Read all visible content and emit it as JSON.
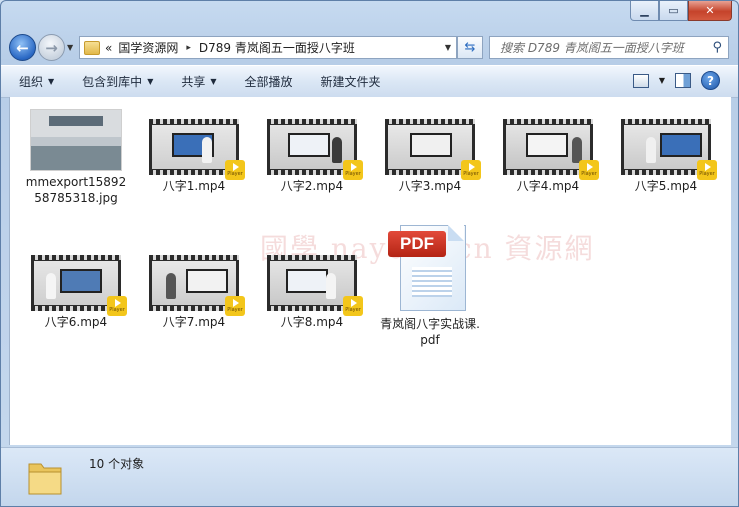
{
  "window": {
    "min_label": "▁",
    "max_label": "▭",
    "close_label": "✕"
  },
  "nav": {
    "back_icon": "arrow-left-icon",
    "forward_icon": "arrow-right-icon",
    "breadcrumb": {
      "overflow": "«",
      "parent": "国学资源网",
      "separator": "▸",
      "current": "D789 青岚阁五一面授八字班"
    },
    "search_placeholder": "搜索 D789 青岚阁五一面授八字班"
  },
  "toolbar": {
    "organize": "组织",
    "include_in_library": "包含到库中",
    "share": "共享",
    "play_all": "全部播放",
    "new_folder": "新建文件夹"
  },
  "files": [
    {
      "name": "mmexport1589258785318.jpg",
      "type": "image"
    },
    {
      "name": "八字1.mp4",
      "type": "video"
    },
    {
      "name": "八字2.mp4",
      "type": "video"
    },
    {
      "name": "八字3.mp4",
      "type": "video"
    },
    {
      "name": "八字4.mp4",
      "type": "video"
    },
    {
      "name": "八字5.mp4",
      "type": "video"
    },
    {
      "name": "八字6.mp4",
      "type": "video"
    },
    {
      "name": "八字7.mp4",
      "type": "video"
    },
    {
      "name": "八字8.mp4",
      "type": "video"
    },
    {
      "name": "青岚阁八字实战课.pdf",
      "type": "pdf"
    }
  ],
  "player_badge": "Player",
  "pdf_badge": "PDF",
  "watermark": "國學 nayona.cn 資源網",
  "status": {
    "count": "10 个对象"
  },
  "colors": {
    "accent": "#2a68c4",
    "player_badge": "#f3c61b",
    "pdf_red": "#c8321f"
  }
}
